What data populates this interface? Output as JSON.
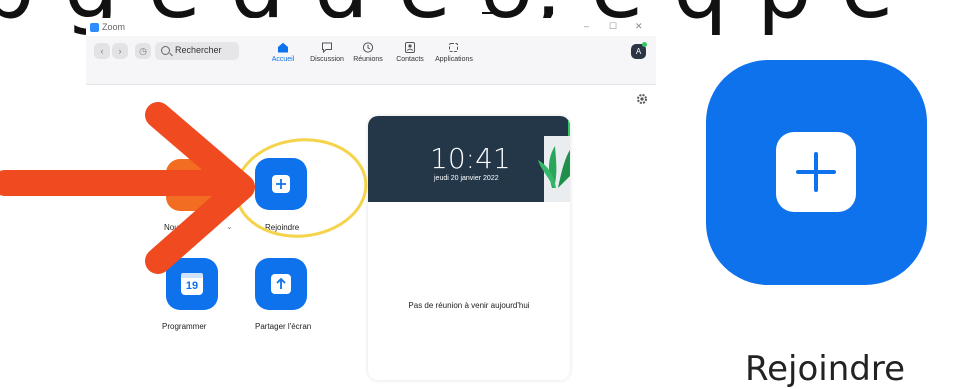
{
  "window": {
    "title": "Zoom",
    "minimize_glyph": "–",
    "maximize_glyph": "☐",
    "close_glyph": "✕"
  },
  "toolbar": {
    "back_glyph": "‹",
    "forward_glyph": "›",
    "history_glyph": "◷",
    "search_placeholder": "Rechercher",
    "tabs": [
      {
        "label": "Accueil",
        "icon": "home-icon",
        "active": true
      },
      {
        "label": "Discussion",
        "icon": "chat-icon",
        "active": false
      },
      {
        "label": "Réunions",
        "icon": "clock-icon",
        "active": false
      },
      {
        "label": "Contacts",
        "icon": "contacts-icon",
        "active": false
      },
      {
        "label": "Applications",
        "icon": "apps-icon",
        "active": false
      }
    ],
    "avatar_initial": "A"
  },
  "home": {
    "actions": [
      {
        "label": "Nou",
        "icon": "video-camera-icon",
        "caret": "⌄"
      },
      {
        "label": "Rejoindre",
        "icon": "plus-icon"
      },
      {
        "label": "Programmer",
        "icon": "calendar-icon",
        "calendar_day": "19"
      },
      {
        "label": "Partager l'écran",
        "icon": "share-arrow-up-icon"
      }
    ]
  },
  "calendar_card": {
    "time": "10:41",
    "date": "jeudi 20 janvier 2022",
    "empty_message": "Pas de réunion à venir aujourd'hui"
  },
  "zoomed_callout": {
    "label": "Rejoindre"
  },
  "colors": {
    "accent": "#0e72ed",
    "arrow": "#f04a20",
    "highlight_circle": "#f5d34a",
    "card_header": "#243749"
  }
}
